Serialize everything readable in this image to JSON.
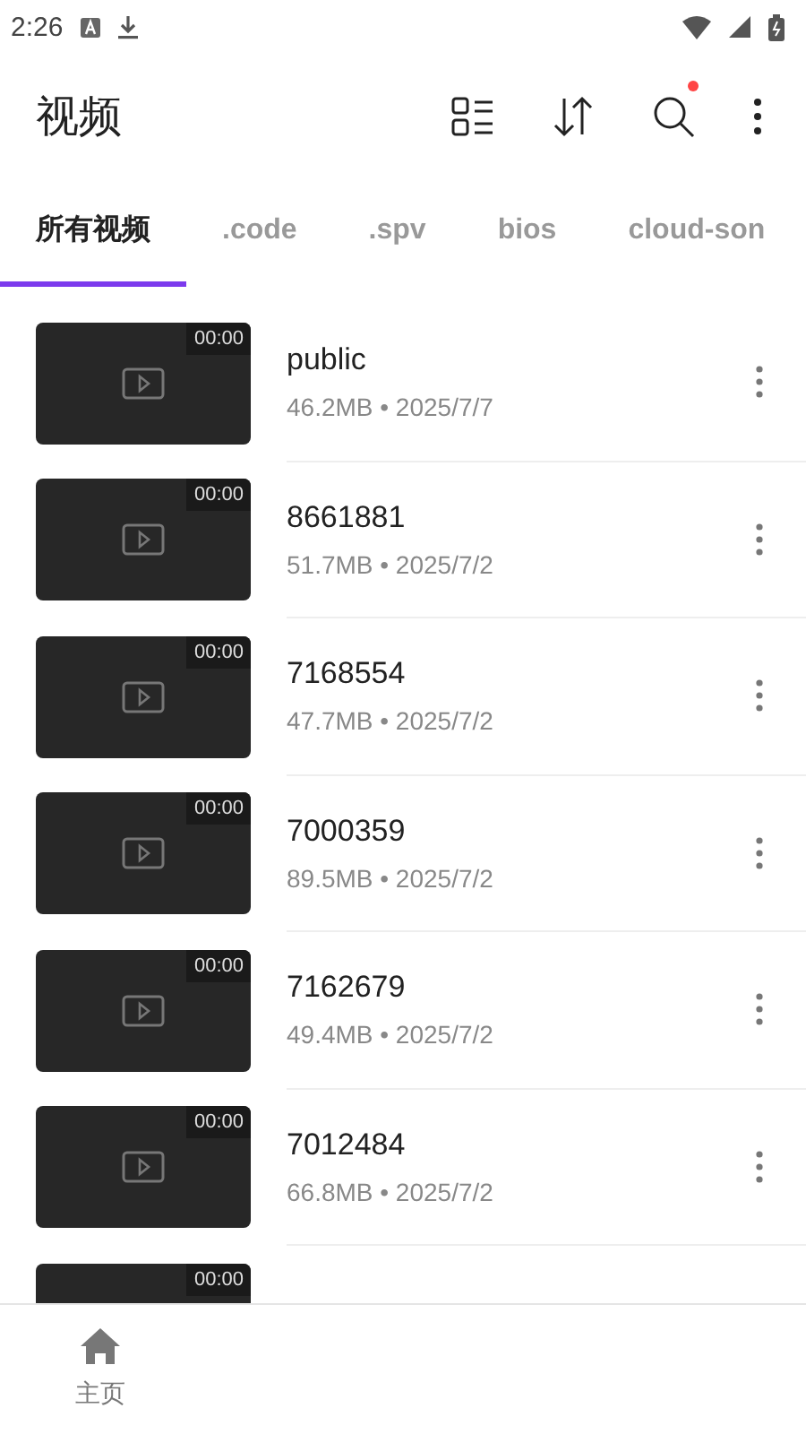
{
  "status_bar": {
    "time": "2:26"
  },
  "app_bar": {
    "title": "视频",
    "search_badge": true
  },
  "tabs": [
    {
      "label": "所有视频",
      "selected": true
    },
    {
      "label": ".code",
      "selected": false
    },
    {
      "label": ".spv",
      "selected": false
    },
    {
      "label": "bios",
      "selected": false
    },
    {
      "label": "cloud-son",
      "selected": false
    }
  ],
  "videos": [
    {
      "duration": "00:00",
      "name": "public",
      "meta": "46.2MB • 2025/7/7"
    },
    {
      "duration": "00:00",
      "name": "8661881",
      "meta": "51.7MB • 2025/7/2"
    },
    {
      "duration": "00:00",
      "name": "7168554",
      "meta": "47.7MB • 2025/7/2"
    },
    {
      "duration": "00:00",
      "name": "7000359",
      "meta": "89.5MB • 2025/7/2"
    },
    {
      "duration": "00:00",
      "name": "7162679",
      "meta": "49.4MB • 2025/7/2"
    },
    {
      "duration": "00:00",
      "name": "7012484",
      "meta": "66.8MB • 2025/7/2"
    },
    {
      "duration": "00:00"
    }
  ],
  "bottom_nav": [
    {
      "label": "主页",
      "selected": true
    }
  ]
}
